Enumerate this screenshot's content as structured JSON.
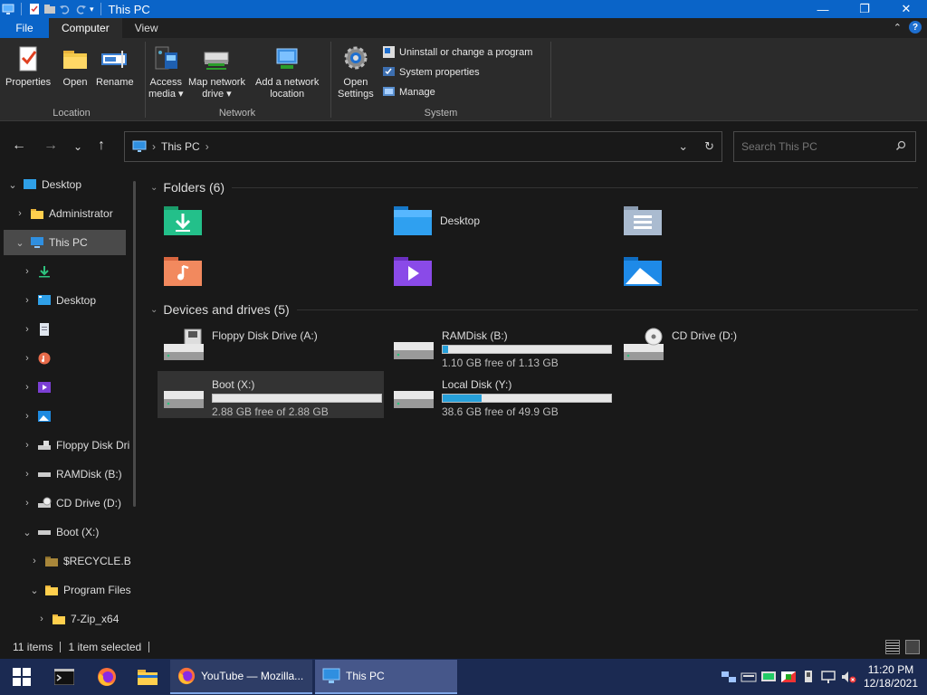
{
  "window": {
    "title": "This PC"
  },
  "ribbon_tabs": [
    "File",
    "Computer",
    "View"
  ],
  "ribbon": {
    "location": {
      "label": "Location",
      "properties": "Properties",
      "open": "Open",
      "rename": "Rename"
    },
    "network": {
      "label": "Network",
      "access_media": [
        "Access",
        "media ▾"
      ],
      "map_drive": [
        "Map network",
        "drive ▾"
      ],
      "add_location": [
        "Add a network",
        "location"
      ]
    },
    "system": {
      "label": "System",
      "open_settings": [
        "Open",
        "Settings"
      ],
      "uninstall": "Uninstall or change a program",
      "system_properties": "System properties",
      "manage": "Manage"
    }
  },
  "address": {
    "crumb": "This PC",
    "search_placeholder": "Search This PC"
  },
  "sidebar": {
    "items": [
      {
        "label": "Desktop",
        "icon": "desktop-blue-icon"
      },
      {
        "label": "Administrator",
        "icon": "folder-icon"
      },
      {
        "label": "This PC",
        "icon": "computer-icon"
      },
      {
        "label": "",
        "icon": "downloads-icon"
      },
      {
        "label": "Desktop",
        "icon": "desktop-icon"
      },
      {
        "label": "",
        "icon": "documents-icon"
      },
      {
        "label": "",
        "icon": "music-icon"
      },
      {
        "label": "",
        "icon": "videos-icon"
      },
      {
        "label": "",
        "icon": "pictures-icon"
      },
      {
        "label": "Floppy Disk Dri",
        "icon": "floppy-drive-icon"
      },
      {
        "label": "RAMDisk (B:)",
        "icon": "drive-icon"
      },
      {
        "label": "CD Drive (D:)",
        "icon": "cd-drive-icon"
      },
      {
        "label": "Boot (X:)",
        "icon": "drive-icon"
      },
      {
        "label": "$RECYCLE.B",
        "icon": "folder-dark-icon"
      },
      {
        "label": "Program Files",
        "icon": "folder-icon"
      },
      {
        "label": "7-Zip_x64",
        "icon": "folder-icon"
      }
    ]
  },
  "content": {
    "folders_header": "Folders (6)",
    "devices_header": "Devices and drives (5)",
    "folders": [
      {
        "label": "",
        "icon": "downloads-folder-icon"
      },
      {
        "label": "Desktop",
        "icon": "desktop-folder-icon"
      },
      {
        "label": "",
        "icon": "documents-folder-icon"
      },
      {
        "label": "",
        "icon": "music-folder-icon"
      },
      {
        "label": "",
        "icon": "videos-folder-icon"
      },
      {
        "label": "",
        "icon": "pictures-folder-icon"
      }
    ],
    "drives": [
      {
        "name": "Floppy Disk Drive (A:)",
        "free": "",
        "used_fraction": null,
        "icon": "floppy-drive-icon"
      },
      {
        "name": "RAMDisk (B:)",
        "free": "1.10 GB free of 1.13 GB",
        "used_fraction": 0.03,
        "icon": "drive-icon"
      },
      {
        "name": "CD Drive (D:)",
        "free": "",
        "used_fraction": null,
        "icon": "cd-drive-icon"
      },
      {
        "name": "Boot (X:)",
        "free": "2.88 GB free of 2.88 GB",
        "used_fraction": 0.0,
        "icon": "drive-icon"
      },
      {
        "name": "Local Disk (Y:)",
        "free": "38.6 GB free of 49.9 GB",
        "used_fraction": 0.23,
        "icon": "drive-icon"
      }
    ]
  },
  "status": {
    "count": "11 items",
    "selected": "1 item selected"
  },
  "taskbar": {
    "apps": [
      {
        "label": "YouTube — Mozilla...",
        "icon": "firefox-icon"
      },
      {
        "label": "This PC",
        "icon": "computer-icon"
      }
    ],
    "time": "11:20 PM",
    "date": "12/18/2021"
  },
  "colors": {
    "accent": "#0a64c8",
    "bar_fill": "#26a0da",
    "taskbar": "#1b2a52"
  }
}
